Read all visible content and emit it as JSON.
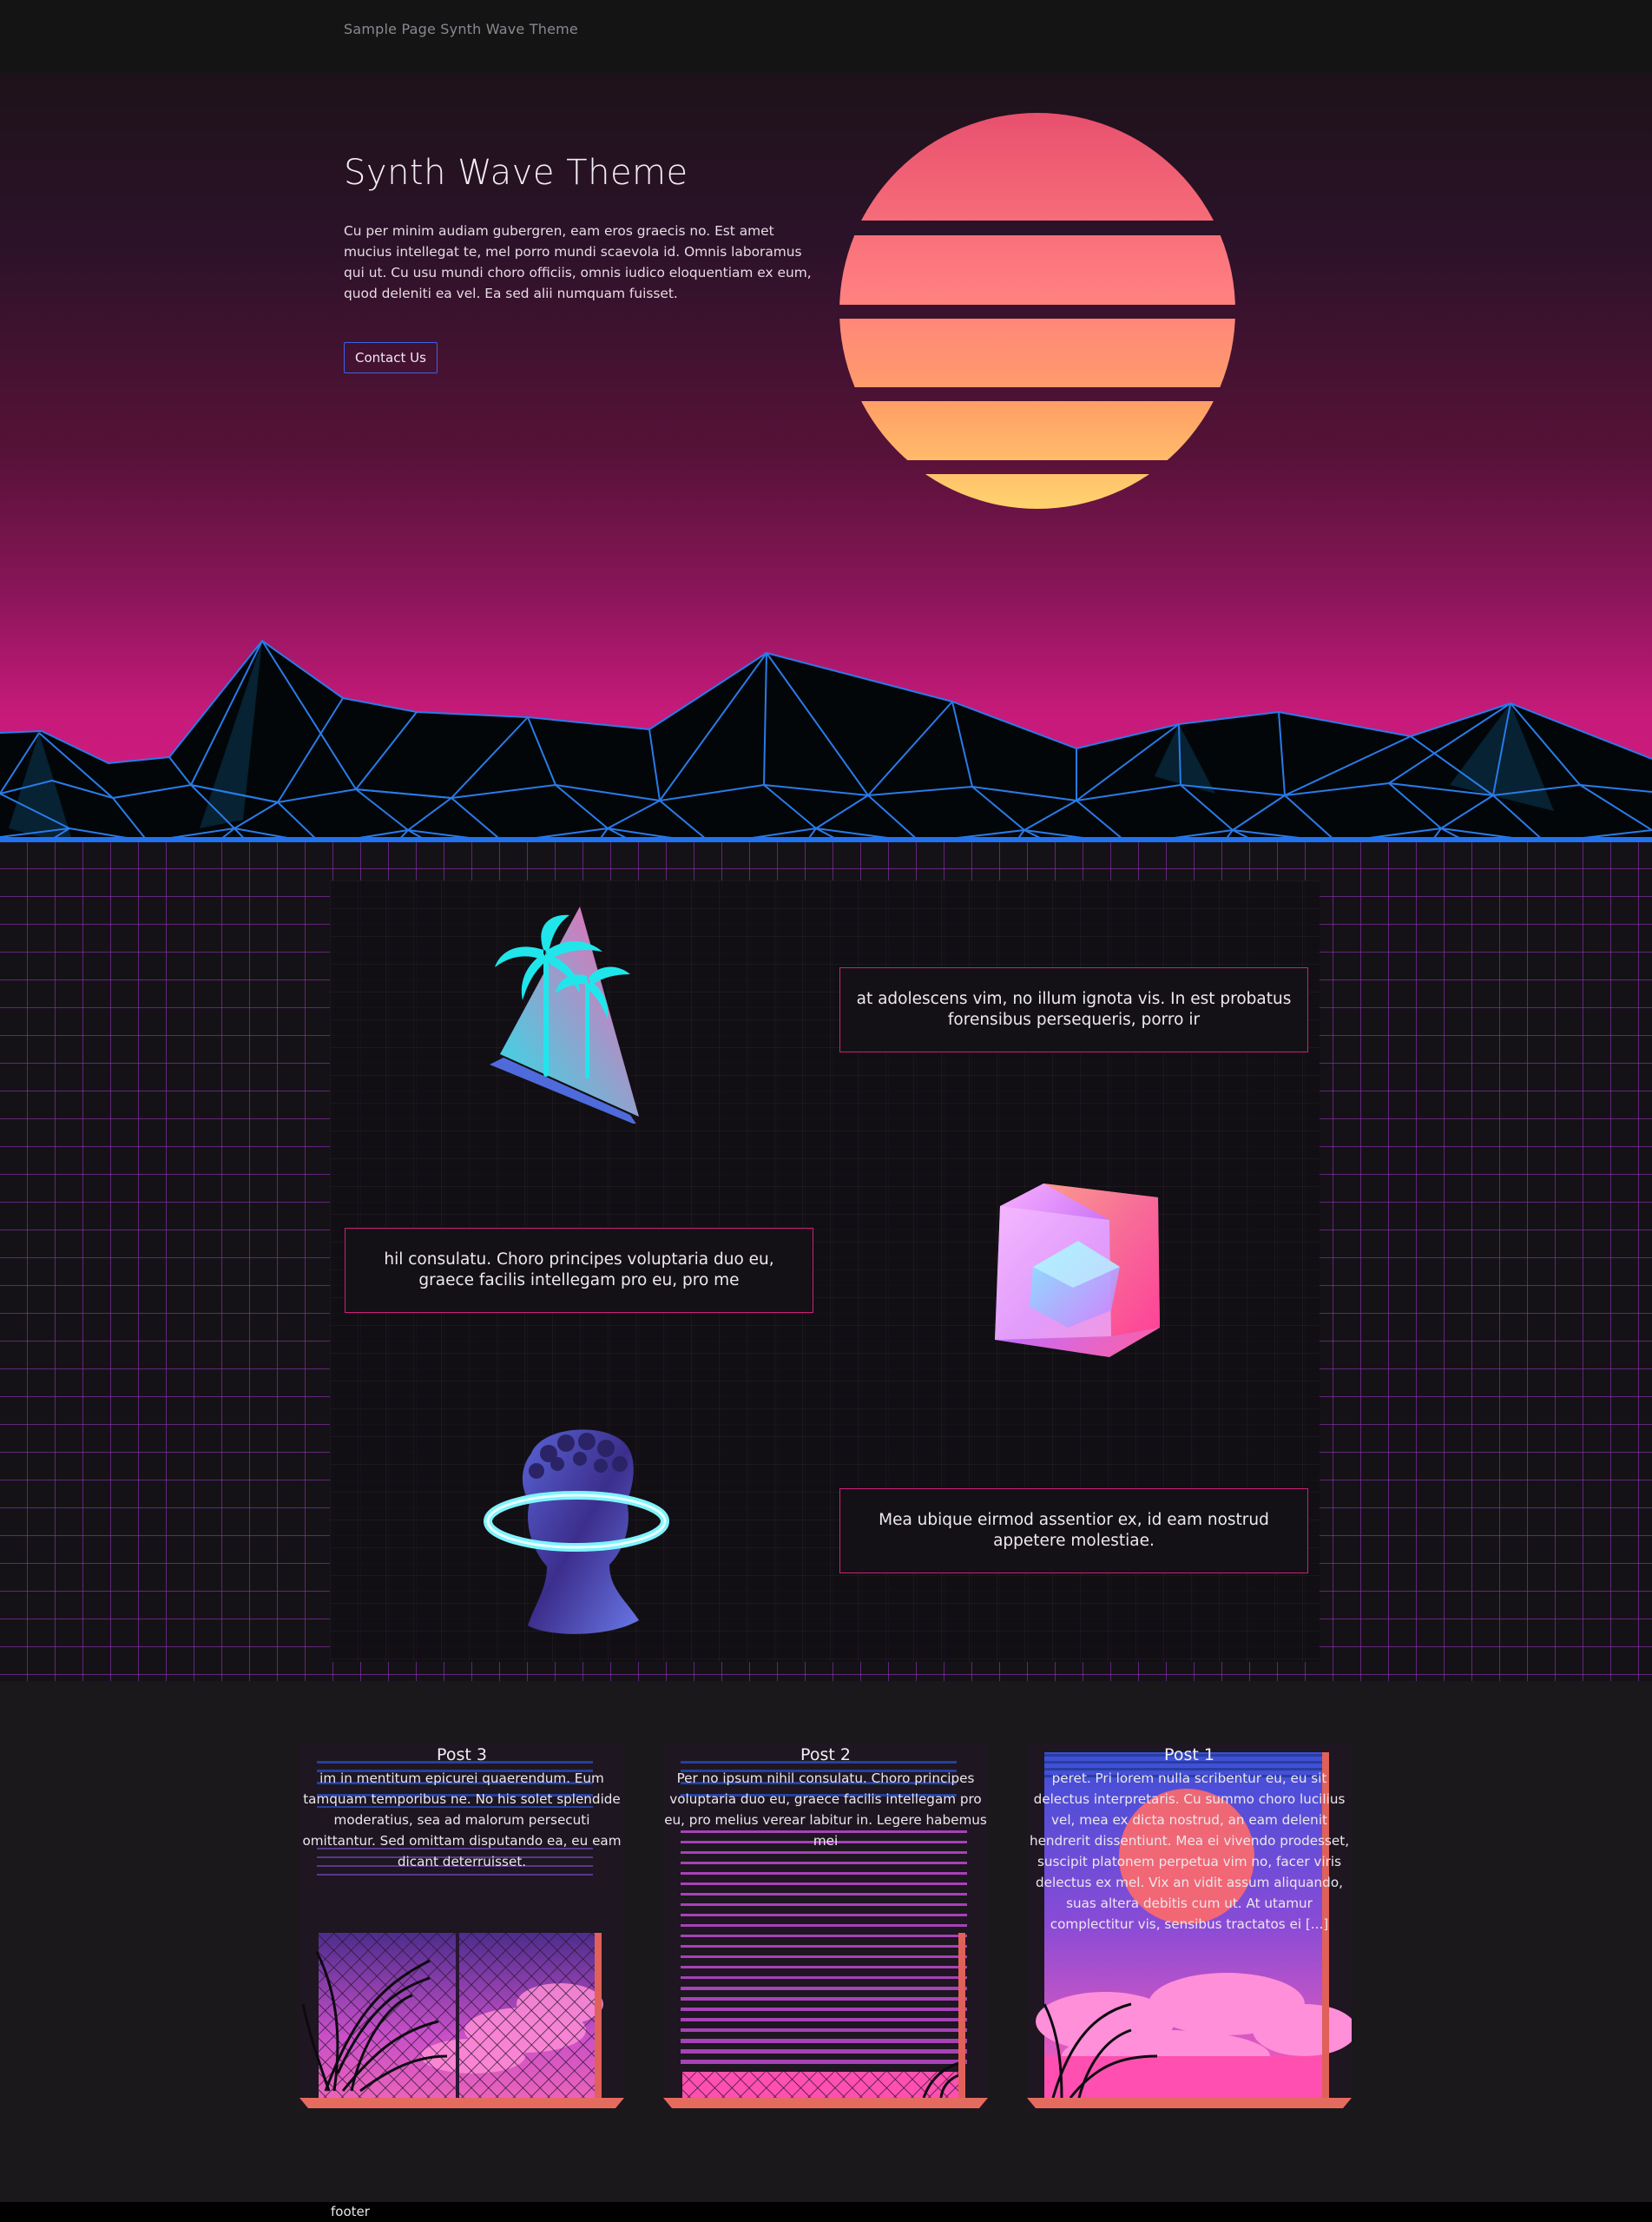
{
  "header": {
    "site_title": "Sample Page Synth Wave Theme"
  },
  "hero": {
    "title": "Synth Wave Theme",
    "text": "Cu per minim audiam gubergren, eam eros graecis no. Est amet mucius intellegat te, mel porro mundi scaevola id. Omnis laboramus qui ut. Cu usu mundi choro officiis, omnis iudico eloquentiam ex eum, quod deleniti ea vel. Ea sed alii numquam fuisset.",
    "button_label": "Contact Us"
  },
  "features": [
    {
      "image": "palm-triangle",
      "text": "at adolescens vim, no illum ignota vis. In est probatus forensibus persequeris, porro ir"
    },
    {
      "image": "holo-cube",
      "text": "hil consulatu. Choro principes voluptaria duo eu, graece facilis intellegam pro eu, pro me"
    },
    {
      "image": "statue-halo",
      "text": "Mea ubique eirmod assentior ex, id eam nostrud appetere molestiae."
    }
  ],
  "posts": [
    {
      "title": "Post 3",
      "excerpt": "im in mentitum epicurei quaerendum. Eum tamquam temporibus ne. No his solet splendide moderatius, sea ad malorum persecuti omittantur. Sed omittam disputando ea, eu eam dicant deterruisset."
    },
    {
      "title": "Post 2",
      "excerpt": "Per no ipsum nihil consulatu. Choro principes voluptaria duo eu, graece facilis intellegam pro eu, pro melius verear labitur in. Legere habemus mei"
    },
    {
      "title": "Post 1",
      "excerpt": "peret. Pri lorem nulla scribentur eu, eu sit delectus interpretaris. Cu summo choro lucilius vel, mea ex dicta nostrud, an eam delenit hendrerit dissentiunt. Mea ei vivendo prodesset, suscipit platonem perpetua vim no, facer viris delectus ex mel. Vix an vidit assum aliquando, suas altera debitis cum ut. At utamur complectitur vis, sensibus tractatos ei [...]"
    }
  ],
  "footer": {
    "label": "footer"
  },
  "colors": {
    "accent_pink": "#d11e7a",
    "neon_blue": "#2372f0",
    "grid_purple": "#a036c8"
  }
}
